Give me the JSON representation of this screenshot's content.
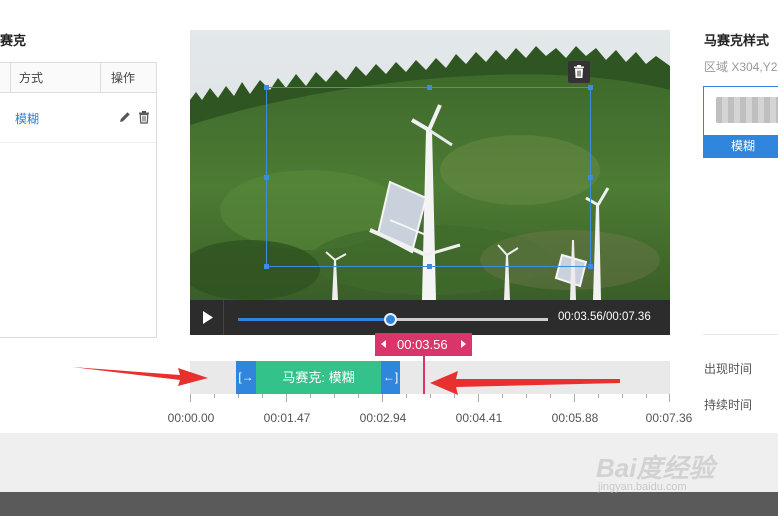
{
  "left_panel": {
    "title": "赛克",
    "columns": [
      "方式",
      "操作"
    ],
    "rows": [
      {
        "type": "模糊"
      }
    ]
  },
  "video": {
    "current_time": "00:03.56",
    "total_time": "00:07.36",
    "time_display": "00:03.56/00:07.36",
    "progress": 0.49
  },
  "timeline": {
    "playhead_label": "00:03.56",
    "clip_label": "马赛克: 模糊",
    "clip_start_icon": "[→",
    "clip_end_icon": "←]",
    "ticks": [
      "00:00.00",
      "00:01.47",
      "00:02.94",
      "00:04.41",
      "00:05.88",
      "00:07.36"
    ]
  },
  "right_panel": {
    "title": "马赛克样式",
    "region": "区域 X304,Y2",
    "style_button": "模糊",
    "appear_time_label": "出现时间",
    "duration_label": "持续时间"
  },
  "watermark": {
    "main": "Bai度经验",
    "sub": "jingyan.baidu.com"
  },
  "colors": {
    "accent_blue": "#2f86dc",
    "clip_green": "#33c38a",
    "playhead_pink": "#d9356a",
    "annotation_red": "#e8302f"
  },
  "icons": {
    "edit": "pencil-icon",
    "delete": "trash-icon",
    "play": "play-icon"
  }
}
